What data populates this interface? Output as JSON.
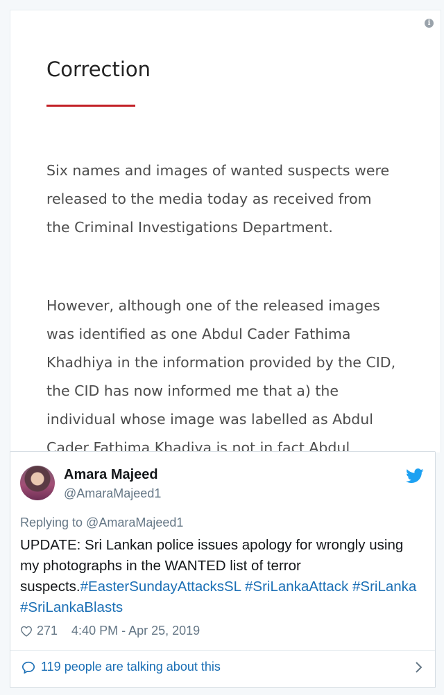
{
  "statement": {
    "title": "Correction",
    "paragraph1": "Six names and images of wanted suspects were\n  released to the media today as received from\nthe Criminal Investigations Department.",
    "paragraph2": "However, although one of the released images\nwas identified as one Abdul Cader Fathima\nKhadhiya in the information provided by the CID,\n the CID has now informed me that a) the\nindividual whose image was labelled as Abdul\nCader Fathima Khadiya is not in fact Abdul\nCader Fathima Khadiya  b) the individual\npictured is not wanted for questioning c) Abdul",
    "info_icon": "i"
  },
  "tweet": {
    "author_name": "Amara Majeed",
    "author_handle": "@AmaraMajeed1",
    "replying_to": "Replying to @AmaraMajeed1",
    "text_plain": "UPDATE: Sri Lankan police issues apology for wrongly using my photographs in the WANTED list of terror suspects.",
    "hashtags": [
      "#EasterSundayAttacksSL",
      "#SriLankaAttack",
      "#SriLanka",
      "#SriLankaBlasts"
    ],
    "like_count": "271",
    "timestamp": "4:40 PM - Apr 25, 2019",
    "talking_about": "119 people are talking about this",
    "icons": [
      "twitter-bird-icon",
      "heart-icon",
      "speech-bubble-icon",
      "chevron-right-icon"
    ]
  },
  "colors": {
    "accent_rule": "#c22026",
    "link_blue": "#1b6fb5",
    "twitter_blue": "#1da1f2"
  }
}
